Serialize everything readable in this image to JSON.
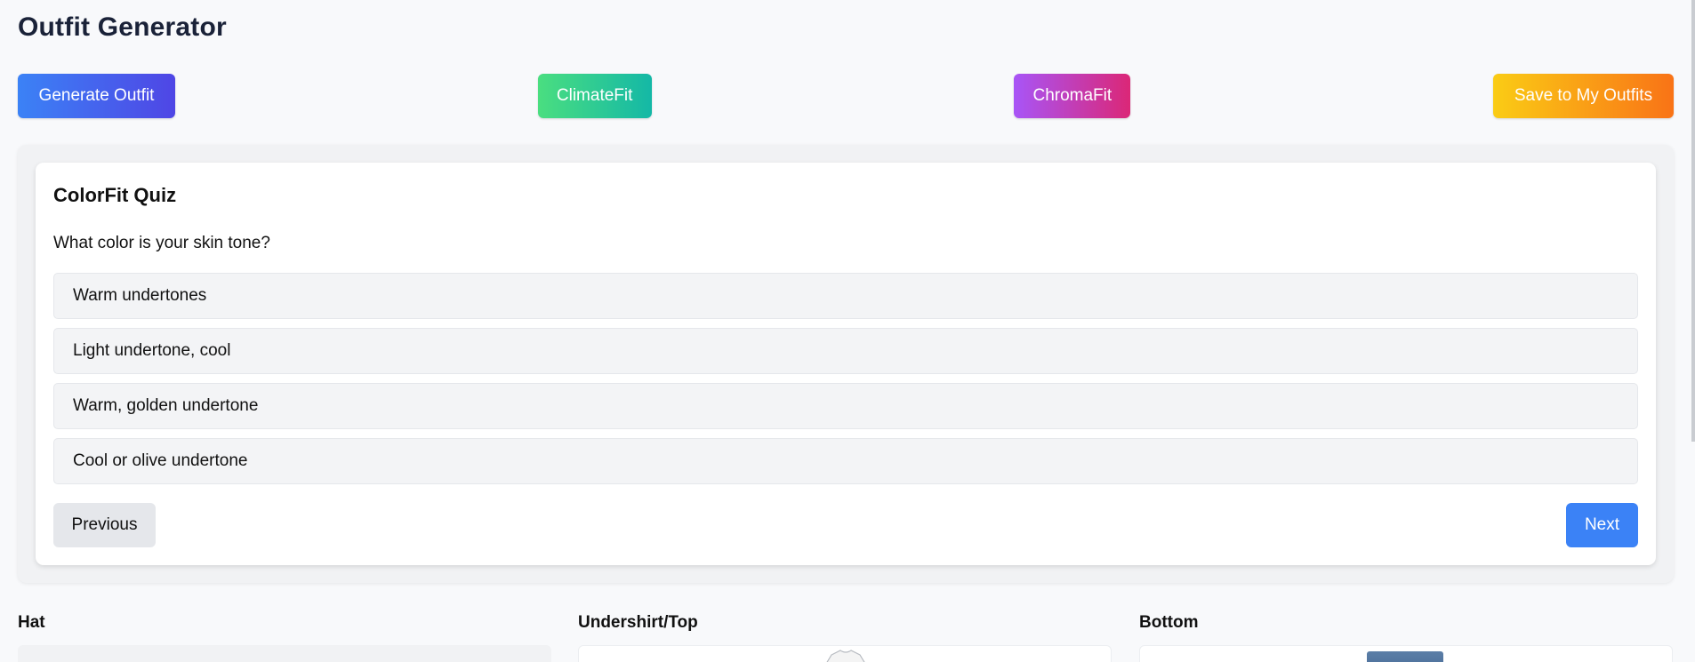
{
  "page": {
    "title": "Outfit Generator"
  },
  "toolbar": {
    "generate_label": "Generate Outfit",
    "climatefit_label": "ClimateFit",
    "chromafit_label": "ChromaFit",
    "save_label": "Save to My Outfits"
  },
  "quiz": {
    "title": "ColorFit Quiz",
    "question": "What color is your skin tone?",
    "options": [
      {
        "label": "Warm undertones"
      },
      {
        "label": "Light undertone, cool"
      },
      {
        "label": "Warm, golden undertone"
      },
      {
        "label": "Cool or olive undertone"
      }
    ],
    "previous_label": "Previous",
    "next_label": "Next"
  },
  "categories": [
    {
      "label": "Hat"
    },
    {
      "label": "Undershirt/Top"
    },
    {
      "label": "Bottom"
    }
  ],
  "colors": {
    "primary_blue": "#3b82f6",
    "climate_green": "#4ade80",
    "chroma_purple": "#a855f7",
    "save_orange": "#f97316"
  }
}
